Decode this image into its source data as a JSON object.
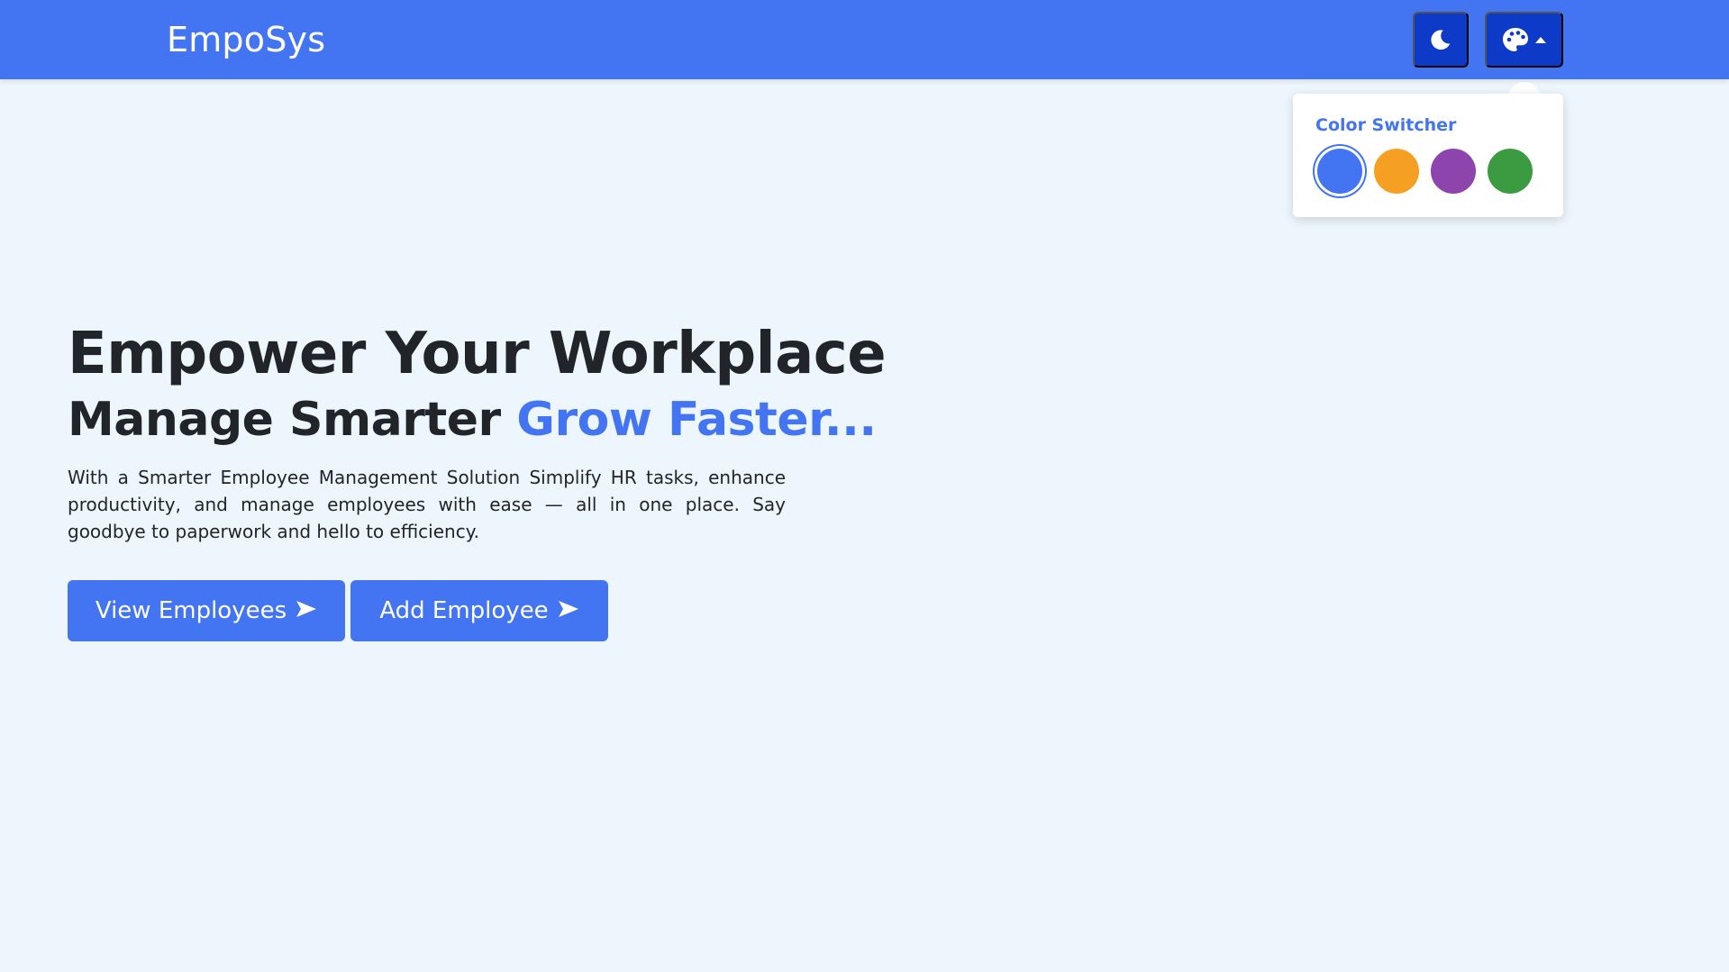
{
  "brand": {
    "name": "EmpoSys"
  },
  "header": {
    "theme_toggle_icon": "moon-icon",
    "palette_toggle_icon": "palette-icon",
    "palette_caret_icon": "caret-up-icon"
  },
  "color_switcher": {
    "title": "Color Switcher",
    "swatches": [
      {
        "name": "blue",
        "color": "#4374f2",
        "active": true
      },
      {
        "name": "orange",
        "color": "#f6a023"
      },
      {
        "name": "purple",
        "color": "#8e44ad"
      },
      {
        "name": "green",
        "color": "#3a9b41"
      }
    ]
  },
  "hero": {
    "heading": "Empower Your Workplace",
    "subheading_prefix": "Manage Smarter",
    "subheading_accent": "Grow Faster...",
    "description": "With a Smarter Employee Management Solution Simplify HR tasks, enhance productivity, and manage employees with ease — all in one place. Say goodbye to paperwork and hello to efficiency.",
    "buttons": [
      {
        "label": "View Employees",
        "icon": "arrow-right-icon"
      },
      {
        "label": "Add Employee",
        "icon": "arrow-right-icon"
      }
    ]
  },
  "colors": {
    "primary": "#4374f2",
    "primary_dark": "#0d3bc7",
    "background": "#eef6fd",
    "text": "#212529"
  }
}
